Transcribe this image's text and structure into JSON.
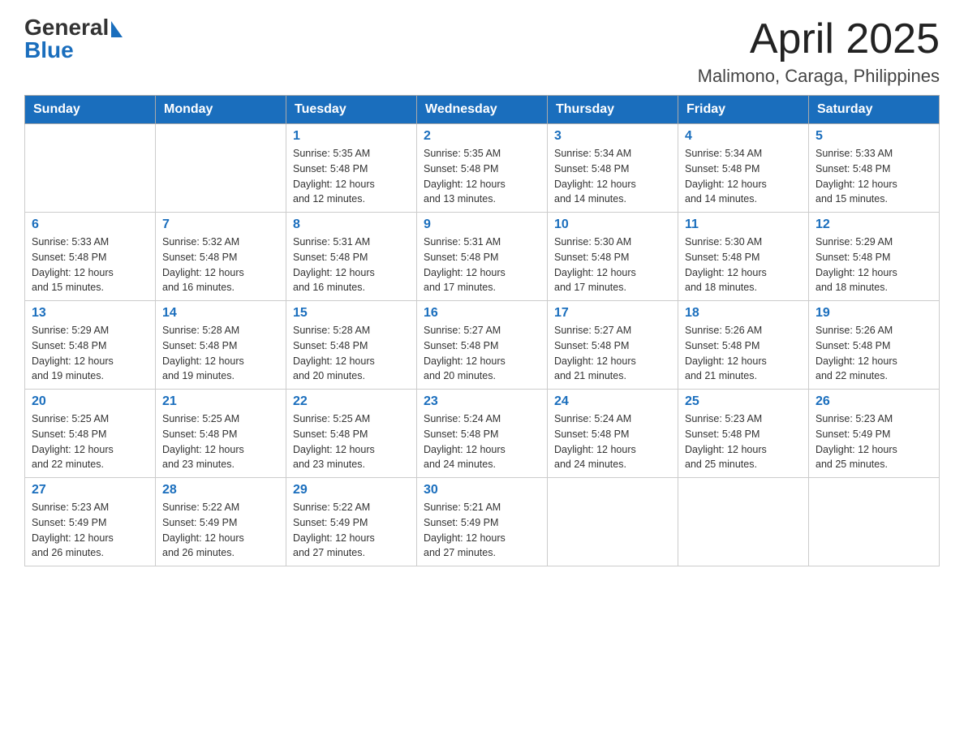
{
  "logo": {
    "general": "General",
    "blue": "Blue"
  },
  "title": "April 2025",
  "subtitle": "Malimono, Caraga, Philippines",
  "days_of_week": [
    "Sunday",
    "Monday",
    "Tuesday",
    "Wednesday",
    "Thursday",
    "Friday",
    "Saturday"
  ],
  "weeks": [
    [
      {
        "day": "",
        "info": ""
      },
      {
        "day": "",
        "info": ""
      },
      {
        "day": "1",
        "info": "Sunrise: 5:35 AM\nSunset: 5:48 PM\nDaylight: 12 hours\nand 12 minutes."
      },
      {
        "day": "2",
        "info": "Sunrise: 5:35 AM\nSunset: 5:48 PM\nDaylight: 12 hours\nand 13 minutes."
      },
      {
        "day": "3",
        "info": "Sunrise: 5:34 AM\nSunset: 5:48 PM\nDaylight: 12 hours\nand 14 minutes."
      },
      {
        "day": "4",
        "info": "Sunrise: 5:34 AM\nSunset: 5:48 PM\nDaylight: 12 hours\nand 14 minutes."
      },
      {
        "day": "5",
        "info": "Sunrise: 5:33 AM\nSunset: 5:48 PM\nDaylight: 12 hours\nand 15 minutes."
      }
    ],
    [
      {
        "day": "6",
        "info": "Sunrise: 5:33 AM\nSunset: 5:48 PM\nDaylight: 12 hours\nand 15 minutes."
      },
      {
        "day": "7",
        "info": "Sunrise: 5:32 AM\nSunset: 5:48 PM\nDaylight: 12 hours\nand 16 minutes."
      },
      {
        "day": "8",
        "info": "Sunrise: 5:31 AM\nSunset: 5:48 PM\nDaylight: 12 hours\nand 16 minutes."
      },
      {
        "day": "9",
        "info": "Sunrise: 5:31 AM\nSunset: 5:48 PM\nDaylight: 12 hours\nand 17 minutes."
      },
      {
        "day": "10",
        "info": "Sunrise: 5:30 AM\nSunset: 5:48 PM\nDaylight: 12 hours\nand 17 minutes."
      },
      {
        "day": "11",
        "info": "Sunrise: 5:30 AM\nSunset: 5:48 PM\nDaylight: 12 hours\nand 18 minutes."
      },
      {
        "day": "12",
        "info": "Sunrise: 5:29 AM\nSunset: 5:48 PM\nDaylight: 12 hours\nand 18 minutes."
      }
    ],
    [
      {
        "day": "13",
        "info": "Sunrise: 5:29 AM\nSunset: 5:48 PM\nDaylight: 12 hours\nand 19 minutes."
      },
      {
        "day": "14",
        "info": "Sunrise: 5:28 AM\nSunset: 5:48 PM\nDaylight: 12 hours\nand 19 minutes."
      },
      {
        "day": "15",
        "info": "Sunrise: 5:28 AM\nSunset: 5:48 PM\nDaylight: 12 hours\nand 20 minutes."
      },
      {
        "day": "16",
        "info": "Sunrise: 5:27 AM\nSunset: 5:48 PM\nDaylight: 12 hours\nand 20 minutes."
      },
      {
        "day": "17",
        "info": "Sunrise: 5:27 AM\nSunset: 5:48 PM\nDaylight: 12 hours\nand 21 minutes."
      },
      {
        "day": "18",
        "info": "Sunrise: 5:26 AM\nSunset: 5:48 PM\nDaylight: 12 hours\nand 21 minutes."
      },
      {
        "day": "19",
        "info": "Sunrise: 5:26 AM\nSunset: 5:48 PM\nDaylight: 12 hours\nand 22 minutes."
      }
    ],
    [
      {
        "day": "20",
        "info": "Sunrise: 5:25 AM\nSunset: 5:48 PM\nDaylight: 12 hours\nand 22 minutes."
      },
      {
        "day": "21",
        "info": "Sunrise: 5:25 AM\nSunset: 5:48 PM\nDaylight: 12 hours\nand 23 minutes."
      },
      {
        "day": "22",
        "info": "Sunrise: 5:25 AM\nSunset: 5:48 PM\nDaylight: 12 hours\nand 23 minutes."
      },
      {
        "day": "23",
        "info": "Sunrise: 5:24 AM\nSunset: 5:48 PM\nDaylight: 12 hours\nand 24 minutes."
      },
      {
        "day": "24",
        "info": "Sunrise: 5:24 AM\nSunset: 5:48 PM\nDaylight: 12 hours\nand 24 minutes."
      },
      {
        "day": "25",
        "info": "Sunrise: 5:23 AM\nSunset: 5:48 PM\nDaylight: 12 hours\nand 25 minutes."
      },
      {
        "day": "26",
        "info": "Sunrise: 5:23 AM\nSunset: 5:49 PM\nDaylight: 12 hours\nand 25 minutes."
      }
    ],
    [
      {
        "day": "27",
        "info": "Sunrise: 5:23 AM\nSunset: 5:49 PM\nDaylight: 12 hours\nand 26 minutes."
      },
      {
        "day": "28",
        "info": "Sunrise: 5:22 AM\nSunset: 5:49 PM\nDaylight: 12 hours\nand 26 minutes."
      },
      {
        "day": "29",
        "info": "Sunrise: 5:22 AM\nSunset: 5:49 PM\nDaylight: 12 hours\nand 27 minutes."
      },
      {
        "day": "30",
        "info": "Sunrise: 5:21 AM\nSunset: 5:49 PM\nDaylight: 12 hours\nand 27 minutes."
      },
      {
        "day": "",
        "info": ""
      },
      {
        "day": "",
        "info": ""
      },
      {
        "day": "",
        "info": ""
      }
    ]
  ]
}
